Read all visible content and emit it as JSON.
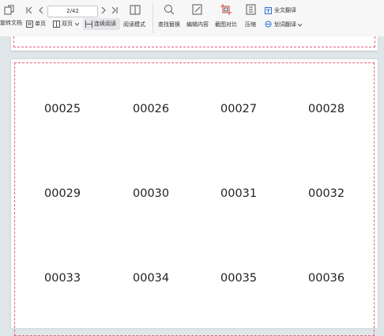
{
  "toolbar": {
    "rotate_doc": "旋转文档",
    "page_input_value": "2/42",
    "single_page": "单页",
    "double_page": "双页",
    "continuous_read": "连续阅读",
    "read_mode": "阅读模式",
    "find_replace": "查找替换",
    "edit_content": "编辑内容",
    "screenshot_compare": "截图对比",
    "compress": "压缩",
    "full_translate": "全文翻译",
    "word_translate": "划词翻译"
  },
  "page": {
    "cells": [
      [
        "00025",
        "00026",
        "00027",
        "00028"
      ],
      [
        "00029",
        "00030",
        "00031",
        "00032"
      ],
      [
        "00033",
        "00034",
        "00035",
        "00036"
      ]
    ]
  },
  "colors": {
    "accent": "#2b6fd6",
    "margin_border": "#e8607a",
    "background": "#dfe6ea"
  }
}
